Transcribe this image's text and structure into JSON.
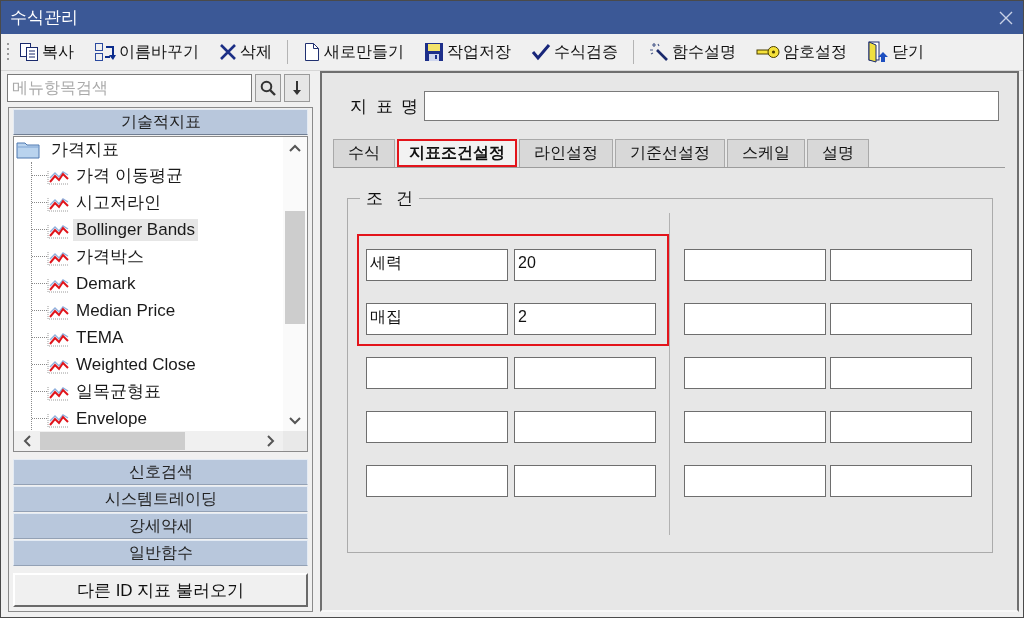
{
  "window": {
    "title": "수식관리"
  },
  "toolbar": {
    "groups": [
      {
        "buttons": [
          {
            "kind": "copy",
            "label": "복사"
          },
          {
            "kind": "rename",
            "label": "이름바꾸기"
          },
          {
            "kind": "delete",
            "label": "삭제"
          }
        ]
      },
      {
        "buttons": [
          {
            "kind": "new",
            "label": "새로만들기"
          },
          {
            "kind": "save",
            "label": "작업저장"
          },
          {
            "kind": "verify",
            "label": "수식검증"
          }
        ]
      },
      {
        "buttons": [
          {
            "kind": "wand",
            "label": "함수설명"
          },
          {
            "kind": "key",
            "label": "암호설정"
          },
          {
            "kind": "exit",
            "label": "닫기"
          }
        ]
      }
    ]
  },
  "sidebar": {
    "search": {
      "placeholder": "메뉴항목검색"
    },
    "sections": [
      {
        "label": "기술적지표",
        "expanded": true,
        "tree": [
          {
            "label": "가격지표",
            "selected": false,
            "children": [
              {
                "label": "가격 이동평균",
                "selected": false
              },
              {
                "label": "시고저라인",
                "selected": false
              },
              {
                "label": "Bollinger Bands",
                "selected": true
              },
              {
                "label": "가격박스",
                "selected": false
              },
              {
                "label": "Demark",
                "selected": false
              },
              {
                "label": "Median Price",
                "selected": false
              },
              {
                "label": "TEMA",
                "selected": false
              },
              {
                "label": "Weighted Close",
                "selected": false
              },
              {
                "label": "일목균형표",
                "selected": false
              },
              {
                "label": "Envelope",
                "selected": false
              }
            ]
          }
        ]
      },
      {
        "label": "신호검색",
        "expanded": false
      },
      {
        "label": "시스템트레이딩",
        "expanded": false
      },
      {
        "label": "강세약세",
        "expanded": false
      },
      {
        "label": "일반함수",
        "expanded": false
      }
    ],
    "load_button": "다른 ID 지표 불러오기"
  },
  "editor": {
    "name_field": {
      "label": "지 표 명"
    },
    "tabs": [
      {
        "label": "수식",
        "selected": false
      },
      {
        "label": "지표조건설정",
        "selected": true
      },
      {
        "label": "라인설정",
        "selected": false
      },
      {
        "label": "기준선설정",
        "selected": false
      },
      {
        "label": "스케일",
        "selected": false
      },
      {
        "label": "설명",
        "selected": false
      }
    ],
    "conditions": {
      "title": "조 건",
      "columns": [
        {
          "groups": [
            {
              "highlighted": true,
              "rows": [
                {
                  "name": "세력",
                  "value": "20"
                },
                {
                  "name": "매집",
                  "value": "2"
                }
              ]
            },
            {
              "highlighted": false,
              "rows": [
                {},
                {},
                {}
              ]
            }
          ]
        },
        {
          "groups": [
            {
              "highlighted": false,
              "rows": [
                {},
                {},
                {},
                {},
                {}
              ]
            }
          ]
        }
      ]
    }
  }
}
